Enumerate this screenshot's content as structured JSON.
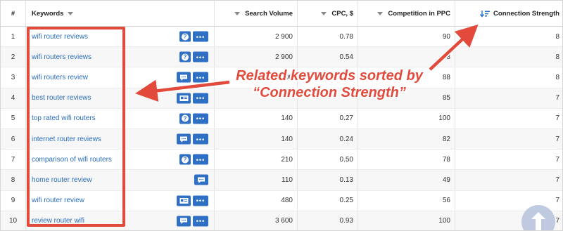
{
  "table": {
    "headers": {
      "num": "#",
      "keywords": "Keywords",
      "search_volume": "Search Volume",
      "cpc": "CPC, $",
      "competition": "Competition in PPC",
      "connection": "Connection Strength"
    },
    "rows": [
      {
        "num": "1",
        "keyword": "wifi router reviews",
        "icons": [
          "question",
          "more"
        ],
        "volume": "2 900",
        "cpc": "0.78",
        "competition": "90",
        "connection": "8"
      },
      {
        "num": "2",
        "keyword": "wifi routers reviews",
        "icons": [
          "question",
          "more"
        ],
        "volume": "2 900",
        "cpc": "0.54",
        "competition": "88",
        "connection": "8"
      },
      {
        "num": "3",
        "keyword": "wifi routers review",
        "icons": [
          "chat",
          "more"
        ],
        "volume": "2 900",
        "cpc": "0.54",
        "competition": "88",
        "connection": "8"
      },
      {
        "num": "4",
        "keyword": "best router reviews",
        "icons": [
          "card",
          "more"
        ],
        "volume": "",
        "cpc": "",
        "competition": "85",
        "connection": "7"
      },
      {
        "num": "5",
        "keyword": "top rated wifi routers",
        "icons": [
          "question",
          "more"
        ],
        "volume": "140",
        "cpc": "0.27",
        "competition": "100",
        "connection": "7"
      },
      {
        "num": "6",
        "keyword": "internet router reviews",
        "icons": [
          "chat",
          "more"
        ],
        "volume": "140",
        "cpc": "0.24",
        "competition": "82",
        "connection": "7"
      },
      {
        "num": "7",
        "keyword": "comparison of wifi routers",
        "icons": [
          "question",
          "more"
        ],
        "volume": "210",
        "cpc": "0.50",
        "competition": "78",
        "connection": "7"
      },
      {
        "num": "8",
        "keyword": "home router review",
        "icons": [
          "chat"
        ],
        "volume": "110",
        "cpc": "0.13",
        "competition": "49",
        "connection": "7"
      },
      {
        "num": "9",
        "keyword": "wifi router review",
        "icons": [
          "card",
          "more"
        ],
        "volume": "480",
        "cpc": "0.25",
        "competition": "56",
        "connection": "7"
      },
      {
        "num": "10",
        "keyword": "review router wifi",
        "icons": [
          "chat",
          "more"
        ],
        "volume": "3 600",
        "cpc": "0.93",
        "competition": "100",
        "connection": "7"
      }
    ]
  },
  "annotation": {
    "line1": "Related keywords sorted by",
    "line2": "“Connection Strength”",
    "color": "#e24a3c"
  },
  "colors": {
    "accent": "#2f6fc4",
    "link": "#2a6ebb"
  }
}
